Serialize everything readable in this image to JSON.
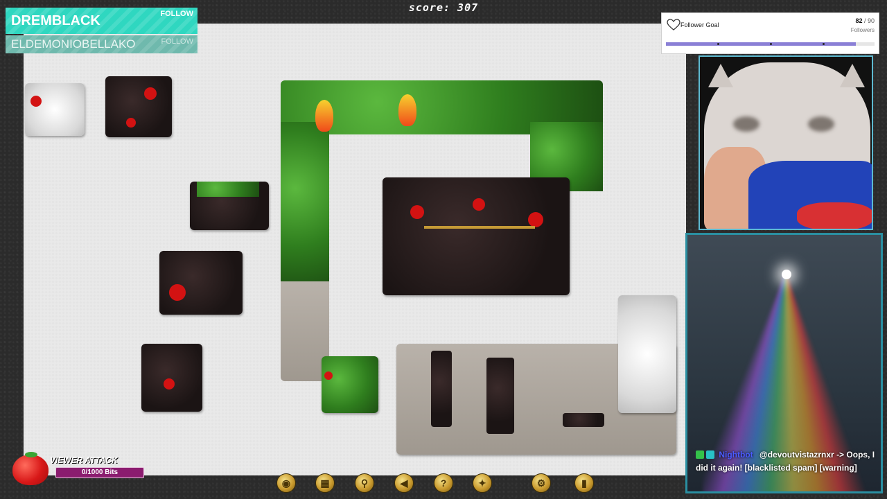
{
  "score_text": "score: 307",
  "follow_banners": [
    {
      "name": "DREMBLACK",
      "button": "FOLLOW"
    },
    {
      "name": "ELDEMONIOBELLAKO",
      "button": "FOLLOW"
    }
  ],
  "follower_goal": {
    "title": "Follower Goal",
    "current": "82",
    "separator": "/ 90",
    "unit": "Followers",
    "progress": 0.911
  },
  "chat": {
    "username": "Nightbot",
    "message": "@devoutvistazrnxr -> Oops, I did it again! [blacklisted spam] [warning]"
  },
  "viewer_attack": {
    "title": "VIEWER ATTACK",
    "bits": "0/1000 Bits"
  },
  "toolbar_icons": [
    "eye-icon",
    "image-icon",
    "search-icon",
    "arrow-left-icon",
    "help-icon",
    "magic-wand-icon",
    "settings-icon",
    "exit-icon"
  ],
  "colors": {
    "follow_primary": "#2fd7c0",
    "follow_secondary": "#6fb9ad",
    "goal_fill": "#8a7fd6",
    "chat_border": "#2a8fa1",
    "attack_bar": "#8b1c6f"
  }
}
